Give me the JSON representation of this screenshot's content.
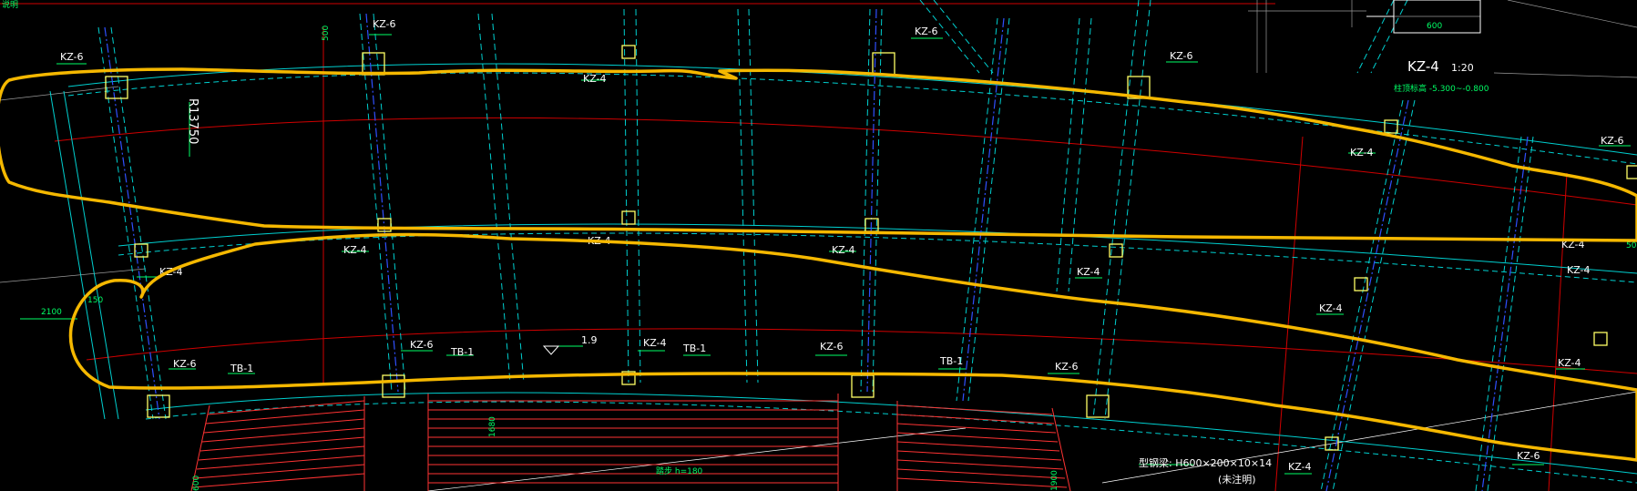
{
  "colors": {
    "background": "#000000",
    "annotation": "#f5b800",
    "axis": "#d00000",
    "beam": "#00d0d0",
    "leader": "#00ff66",
    "text": "#ffffff",
    "column": "#ffff66",
    "stair": "#ff3333"
  },
  "title_block": {
    "detail_title": "KZ-4",
    "detail_scale": "1:20",
    "detail_elevation": "柱顶标高 -5.300~-0.800",
    "detail_dim": "600"
  },
  "corner_label": "说明",
  "radius_label": "R13750",
  "dims": {
    "left_gap": "2100",
    "left_small": "150",
    "stair_width": "1680",
    "stair_left": "600",
    "stair_right": "1900",
    "mid_mark": "1.9",
    "top_dim": "500",
    "right_dim": "50"
  },
  "stair_note": "踏步 h=180",
  "steel_note": "型钢梁: H600×200×10×14",
  "steel_subnote": "(未注明)",
  "column_labels": [
    {
      "id": "c1",
      "text": "KZ-6"
    },
    {
      "id": "c2",
      "text": "KZ-6"
    },
    {
      "id": "c3",
      "text": "KZ-6"
    },
    {
      "id": "c4",
      "text": "KZ-6"
    },
    {
      "id": "c5",
      "text": "KZ-4"
    },
    {
      "id": "c6",
      "text": "KZ-4"
    },
    {
      "id": "c7",
      "text": "KZ-6"
    },
    {
      "id": "c8",
      "text": "KZ-4"
    },
    {
      "id": "c9",
      "text": "KZ-4"
    },
    {
      "id": "c10",
      "text": "KZ-4"
    },
    {
      "id": "c11",
      "text": "KZ-4"
    },
    {
      "id": "c12",
      "text": "KZ-4"
    },
    {
      "id": "c13",
      "text": "KZ-4"
    },
    {
      "id": "c14",
      "text": "KZ-4"
    },
    {
      "id": "c15",
      "text": "KZ-6"
    },
    {
      "id": "c16",
      "text": "KZ-6"
    },
    {
      "id": "c17",
      "text": "KZ-4"
    },
    {
      "id": "c18",
      "text": "KZ-6"
    },
    {
      "id": "c19",
      "text": "KZ-6"
    },
    {
      "id": "c20",
      "text": "KZ-4"
    },
    {
      "id": "c21",
      "text": "KZ-4"
    },
    {
      "id": "c22",
      "text": "KZ-4"
    },
    {
      "id": "c23",
      "text": "KZ-6"
    }
  ],
  "beam_labels": [
    {
      "id": "b1",
      "text": "TB-1"
    },
    {
      "id": "b2",
      "text": "TB-1"
    },
    {
      "id": "b3",
      "text": "TB-1"
    },
    {
      "id": "b4",
      "text": "TB-1"
    }
  ]
}
